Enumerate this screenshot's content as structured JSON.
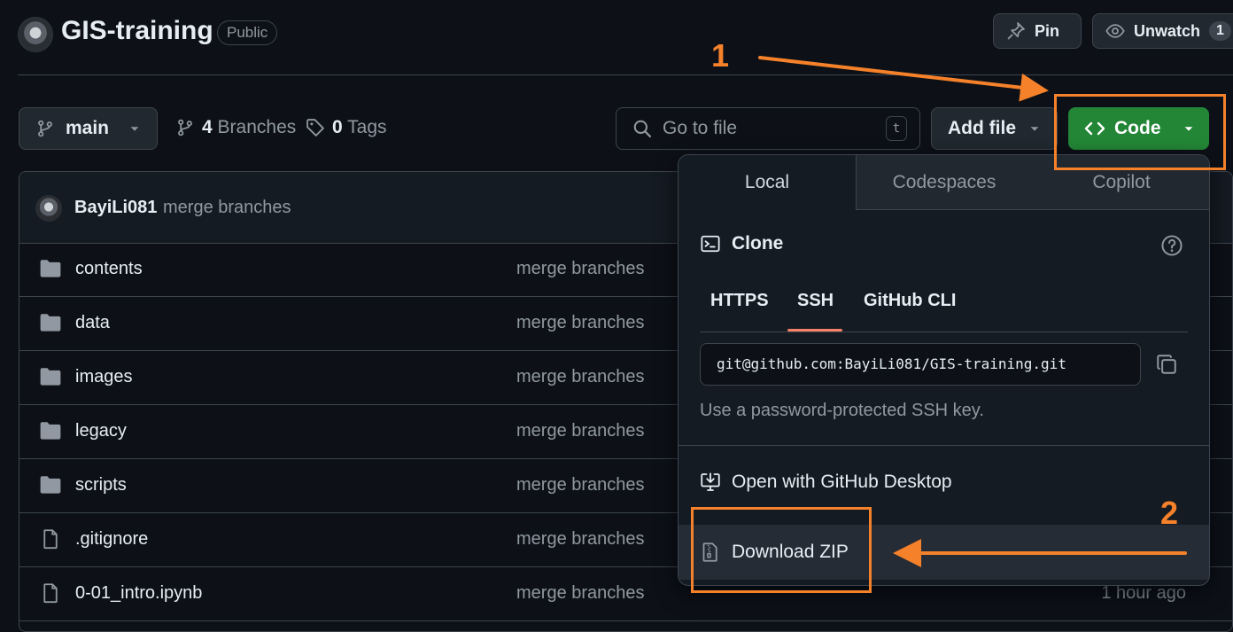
{
  "repo": {
    "name": "GIS-training",
    "visibility": "Public",
    "pin_label": "Pin",
    "watch_label": "Unwatch",
    "watch_count": "1"
  },
  "toolbar": {
    "branch": "main",
    "branches_count": "4",
    "branches_label": "Branches",
    "tags_count": "0",
    "tags_label": "Tags",
    "search_placeholder": "Go to file",
    "search_shortcut": "t",
    "add_file_label": "Add file",
    "code_label": "Code"
  },
  "commit": {
    "author": "BayiLi081",
    "message": "merge branches"
  },
  "files": [
    {
      "name": "contents",
      "type": "folder",
      "message": "merge branches",
      "time": ""
    },
    {
      "name": "data",
      "type": "folder",
      "message": "merge branches",
      "time": ""
    },
    {
      "name": "images",
      "type": "folder",
      "message": "merge branches",
      "time": ""
    },
    {
      "name": "legacy",
      "type": "folder",
      "message": "merge branches",
      "time": ""
    },
    {
      "name": "scripts",
      "type": "folder",
      "message": "merge branches",
      "time": ""
    },
    {
      "name": ".gitignore",
      "type": "file",
      "message": "merge branches",
      "time": ""
    },
    {
      "name": "0-01_intro.ipynb",
      "type": "file",
      "message": "merge branches",
      "time": "1 hour ago"
    }
  ],
  "code_dropdown": {
    "tabs": [
      "Local",
      "Codespaces",
      "Copilot"
    ],
    "active_tab": "Local",
    "clone_title": "Clone",
    "protocols": [
      "HTTPS",
      "SSH",
      "GitHub CLI"
    ],
    "active_protocol": "SSH",
    "clone_url": "git@github.com:BayiLi081/GIS-training.git",
    "ssh_hint": "Use a password-protected SSH key.",
    "open_desktop_label": "Open with GitHub Desktop",
    "download_zip_label": "Download ZIP"
  },
  "annotations": {
    "step1": "1",
    "step2": "2",
    "color": "#f5812a"
  },
  "colors": {
    "background": "#0d1117",
    "code_button": "#238636",
    "border": "#3d444d",
    "active_underline": "#f78166"
  }
}
